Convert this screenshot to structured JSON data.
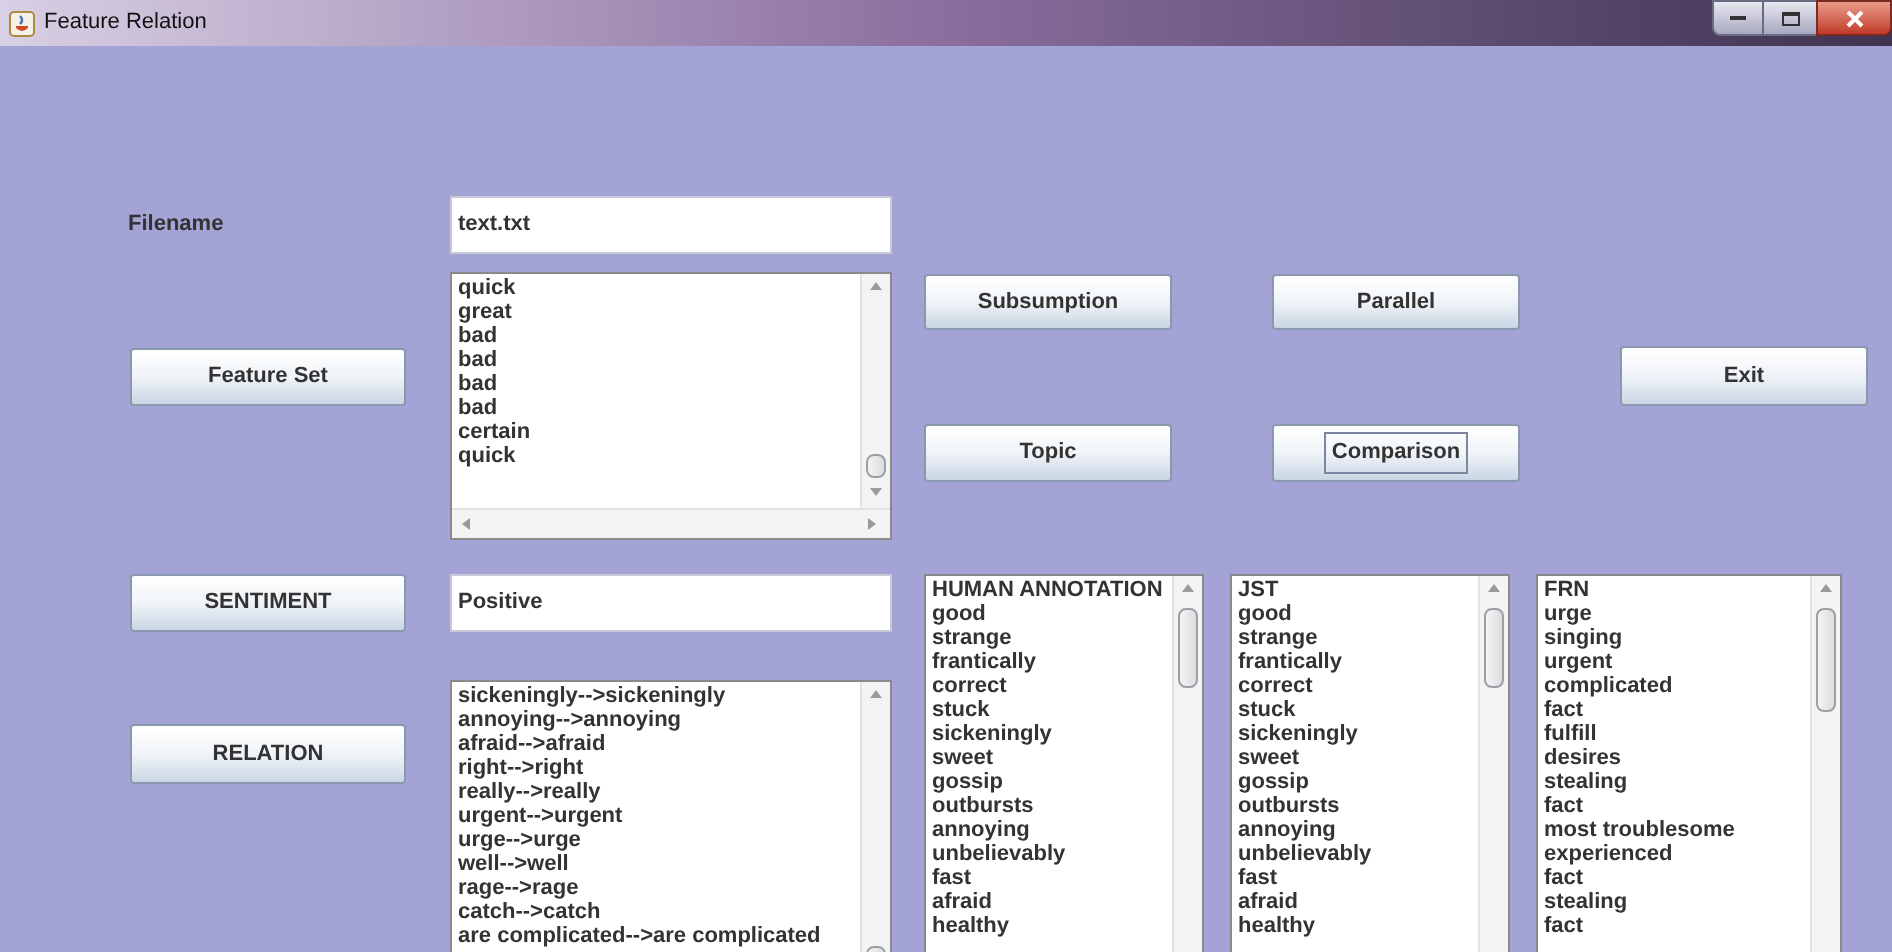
{
  "window": {
    "title": "Feature Relation"
  },
  "filename": {
    "label": "Filename",
    "value": "text.txt"
  },
  "features": {
    "items": [
      "quick",
      "great",
      "bad",
      "bad",
      "bad",
      "bad",
      "certain",
      "quick"
    ]
  },
  "buttons": [
    {
      "label": "Feature Set",
      "focused": false
    },
    {
      "label": "Subsumption",
      "focused": false
    },
    {
      "label": "Parallel",
      "focused": false
    },
    {
      "label": "Exit",
      "focused": false
    },
    {
      "label": "Topic",
      "focused": false
    },
    {
      "label": "Comparison",
      "focused": true
    },
    {
      "label": "SENTIMENT",
      "focused": false
    },
    {
      "label": "RELATION",
      "focused": false
    }
  ],
  "sentiment": {
    "value": "Positive"
  },
  "relations": {
    "items": [
      "sickeningly-->sickeningly",
      "annoying-->annoying",
      "afraid-->afraid",
      "right-->right",
      "really-->really",
      "urgent-->urgent",
      "urge-->urge",
      "well-->well",
      "rage-->rage",
      "catch-->catch",
      "are complicated-->are complicated"
    ]
  },
  "result_lists": [
    {
      "items": [
        "HUMAN ANNOTATION",
        "good",
        "strange",
        "frantically",
        "correct",
        "stuck",
        "sickeningly",
        "sweet",
        "gossip",
        "outbursts",
        "annoying",
        "unbelievably",
        "fast",
        "afraid",
        "healthy"
      ]
    },
    {
      "items": [
        "JST",
        "good",
        "strange",
        "frantically",
        "correct",
        "stuck",
        "sickeningly",
        "sweet",
        "gossip",
        "outbursts",
        "annoying",
        "unbelievably",
        "fast",
        "afraid",
        "healthy"
      ]
    },
    {
      "items": [
        "FRN",
        "urge",
        "singing",
        "urgent",
        "complicated",
        "fact",
        "fulfill",
        "desires",
        "stealing",
        "fact",
        "most troublesome",
        "experienced",
        "fact",
        "stealing",
        "fact"
      ]
    }
  ]
}
